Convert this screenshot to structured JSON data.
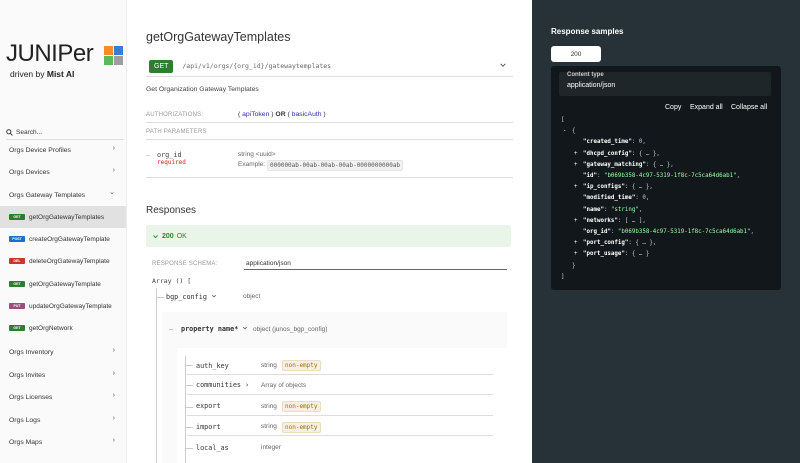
{
  "sidebar": {
    "logo": {
      "wordmark": "JUNIPer",
      "tagline_prefix": "driven by ",
      "tagline_brand": "Mist AI"
    },
    "search_placeholder": "Search...",
    "items": [
      {
        "label": "Orgs Device Profiles",
        "chevron": "›"
      },
      {
        "label": "Orgs Devices",
        "chevron": "›"
      },
      {
        "label": "Orgs Gateway Templates",
        "chevron": "⌄"
      }
    ],
    "subitems": [
      {
        "method": "GET",
        "label": "getOrgGatewayTemplates",
        "color": "#2e7d32",
        "active": true
      },
      {
        "method": "POST",
        "label": "createOrgGatewayTemplate",
        "color": "#186fce"
      },
      {
        "method": "DEL",
        "label": "deleteOrgGatewayTemplate",
        "color": "#cc3333"
      },
      {
        "method": "GET",
        "label": "getOrgGatewayTemplate",
        "color": "#2e7d32"
      },
      {
        "method": "PUT",
        "label": "updateOrgGatewayTemplate",
        "color": "#95507c"
      },
      {
        "method": "GET",
        "label": "getOrgNetwork",
        "color": "#2e7d32"
      }
    ],
    "items_after": [
      {
        "label": "Orgs Inventory",
        "chevron": "›"
      },
      {
        "label": "Orgs Invites",
        "chevron": "›"
      },
      {
        "label": "Orgs Licenses",
        "chevron": "›"
      },
      {
        "label": "Orgs Logs",
        "chevron": "›"
      },
      {
        "label": "Orgs Maps",
        "chevron": "›"
      }
    ]
  },
  "main": {
    "title": "getOrgGatewayTemplates",
    "method": "GET",
    "path": "/api/v1/orgs/{org_id}/gatewaytemplates",
    "description": "Get Organization Gateway Templates",
    "auth_label": "AUTHORIZATIONS:",
    "auth_open": "( ",
    "auth_1": "apiToken",
    "auth_close": " )",
    "auth_or": " OR ",
    "auth_2": "basicAuth",
    "path_params_label": "PATH PARAMETERS",
    "param_name": "org_id",
    "param_required": "required",
    "param_type": "string <uuid>",
    "param_example_label": "Example:",
    "param_example": "000000ab-00ab-00ab-00ab-0000000000ab",
    "responses_title": "Responses",
    "response_code": "200",
    "response_text": "OK",
    "schema_label": "RESPONSE SCHEMA:",
    "schema_type": "application/json",
    "array_line": "Array () [",
    "bgp_config": "bgp_config",
    "bgp_type": "object",
    "property_name": "property name*",
    "property_type": "object (junos_bgp_config)",
    "fields": [
      {
        "name": "auth_key",
        "type": "string",
        "meta": "non-empty"
      },
      {
        "name": "communities",
        "type": "Array of objects",
        "meta": "",
        "expand": "›"
      },
      {
        "name": "export",
        "type": "string",
        "meta": "non-empty"
      },
      {
        "name": "import",
        "type": "string",
        "meta": "non-empty"
      },
      {
        "name": "local_as",
        "type": "integer",
        "meta": ""
      }
    ]
  },
  "panel": {
    "title": "Response samples",
    "tab": "200",
    "content_type_label": "Content type",
    "content_type": "application/json",
    "copy": "Copy",
    "expand_all": "Expand all",
    "collapse_all": "Collapse all"
  },
  "json_sample": [
    {
      "indent": 0,
      "toggle": "",
      "text": "["
    },
    {
      "indent": 1,
      "toggle": "-",
      "text": "{"
    },
    {
      "indent": 2,
      "toggle": "",
      "key": "\"created_time\"",
      "val": "0",
      "vclass": "jn",
      "comma": ","
    },
    {
      "indent": 2,
      "toggle": "+",
      "key": "\"dhcpd_config\"",
      "val": "{ … }",
      "vclass": "jp",
      "comma": ","
    },
    {
      "indent": 2,
      "toggle": "+",
      "key": "\"gateway_matching\"",
      "val": "{ … }",
      "vclass": "jp",
      "comma": ","
    },
    {
      "indent": 2,
      "toggle": "",
      "key": "\"id\"",
      "val": "\"b069b358-4c97-5319-1f8c-7c5ca64d6ab1\"",
      "vclass": "js",
      "comma": ","
    },
    {
      "indent": 2,
      "toggle": "+",
      "key": "\"ip_configs\"",
      "val": "{ … }",
      "vclass": "jp",
      "comma": ","
    },
    {
      "indent": 2,
      "toggle": "",
      "key": "\"modified_time\"",
      "val": "0",
      "vclass": "jn",
      "comma": ","
    },
    {
      "indent": 2,
      "toggle": "",
      "key": "\"name\"",
      "val": "\"string\"",
      "vclass": "js",
      "comma": ","
    },
    {
      "indent": 2,
      "toggle": "+",
      "key": "\"networks\"",
      "val": "[ … ]",
      "vclass": "jp",
      "comma": ","
    },
    {
      "indent": 2,
      "toggle": "",
      "key": "\"org_id\"",
      "val": "\"b069b358-4c97-5319-1f8c-7c5ca64d6ab1\"",
      "vclass": "js",
      "comma": ","
    },
    {
      "indent": 2,
      "toggle": "+",
      "key": "\"port_config\"",
      "val": "{ … }",
      "vclass": "jp",
      "comma": ","
    },
    {
      "indent": 2,
      "toggle": "+",
      "key": "\"port_usage\"",
      "val": "{ … }",
      "vclass": "jp",
      "comma": ""
    },
    {
      "indent": 1,
      "toggle": "",
      "text": "}"
    },
    {
      "indent": 0,
      "toggle": "",
      "text": "]"
    }
  ]
}
